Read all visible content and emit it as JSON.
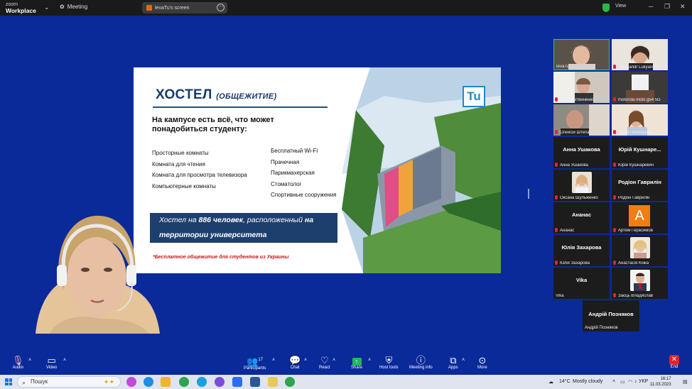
{
  "titlebar": {
    "brand_line1": "zoom",
    "brand_line2": "Workplace",
    "meeting_label": "Meeting",
    "share_label": "levaTu's screen",
    "view_label": "View"
  },
  "slide": {
    "title_main": "ХОСТЕЛ",
    "title_sub": "(ОБЩЕЖИТИЕ)",
    "lead": "На кампусе есть всё, что может понадобиться студенту:",
    "col1": [
      "Просторные комнаты",
      "Комната для чтения",
      "Комната для просмотра телевизора",
      "Компьютерные комнаты"
    ],
    "col2": [
      "Бесплатный Wi-Fi",
      "Прачечная",
      "Парикмахерская",
      "Стоматолог",
      "Спортивные сооружения"
    ],
    "banner_a": "Хостел на ",
    "banner_b": "886 человек",
    "banner_c": ", расположенный ",
    "banner_d": "на",
    "banner_line2": "территории университета",
    "note": "*Бесплатное общежитие для студентов из Украины",
    "logo": "Tu"
  },
  "gallery": [
    {
      "name": "IevaTu",
      "big": "",
      "type": "video",
      "muted": false,
      "active": true
    },
    {
      "name": "Oleksandr Lukyanenko",
      "big": "",
      "type": "video",
      "muted": true
    },
    {
      "name": "Алла Литвиненко",
      "big": "",
      "type": "video",
      "muted": true
    },
    {
      "name": "motorola moto g54 5G",
      "big": "",
      "type": "video",
      "muted": true
    },
    {
      "name": "Олексій Штепа",
      "big": "",
      "type": "video",
      "muted": true
    },
    {
      "name": "Дарія Попельнюх",
      "big": "",
      "type": "video",
      "muted": true
    },
    {
      "name": "Анна Ушакова",
      "big": "Анна Ушакова",
      "type": "name",
      "muted": true
    },
    {
      "name": "Юрій Кушнаревич",
      "big": "Юрій Кушнаре...",
      "type": "name",
      "muted": true
    },
    {
      "name": "Оксана Шульженко",
      "big": "",
      "type": "photo",
      "muted": true
    },
    {
      "name": "Родіон Гаврилін",
      "big": "Родіон Гаврилін",
      "type": "name",
      "muted": true
    },
    {
      "name": "Ананас",
      "big": "Ананас",
      "type": "name",
      "muted": true
    },
    {
      "name": "Артем Герасимов",
      "big": "A",
      "type": "letter",
      "muted": true
    },
    {
      "name": "Юлія Захарова",
      "big": "Юлія Захарова",
      "type": "name",
      "muted": true
    },
    {
      "name": "Анастасія Кожа",
      "big": "",
      "type": "photo",
      "muted": true
    },
    {
      "name": "Vika",
      "big": "Vika",
      "type": "name",
      "muted": false
    },
    {
      "name": "Заєць Владислав",
      "big": "",
      "type": "photo",
      "muted": true
    }
  ],
  "extra_tile": {
    "big": "Андрій Позняков",
    "name": "Андрій Позняков"
  },
  "toolbar": {
    "audio": "Audio",
    "video": "Video",
    "participants": "Participants",
    "participants_count": "17",
    "chat": "Chat",
    "react": "React",
    "share": "Share",
    "host_tools": "Host tools",
    "meeting_info": "Meeting info",
    "apps": "Apps",
    "more": "More",
    "end": "End"
  },
  "taskbar": {
    "search": "Пошук",
    "weather": "14°C",
    "weather_desc": "Mostly cloudy",
    "lang": "УКР",
    "time": "16:17",
    "date": "11.03.2023"
  },
  "colors": {
    "meeting_bg": "#0a2a9a",
    "slide_navy": "#1d3f6e",
    "note_red": "#c0171f",
    "active_border": "#23d160",
    "end_red": "#e0242d"
  }
}
